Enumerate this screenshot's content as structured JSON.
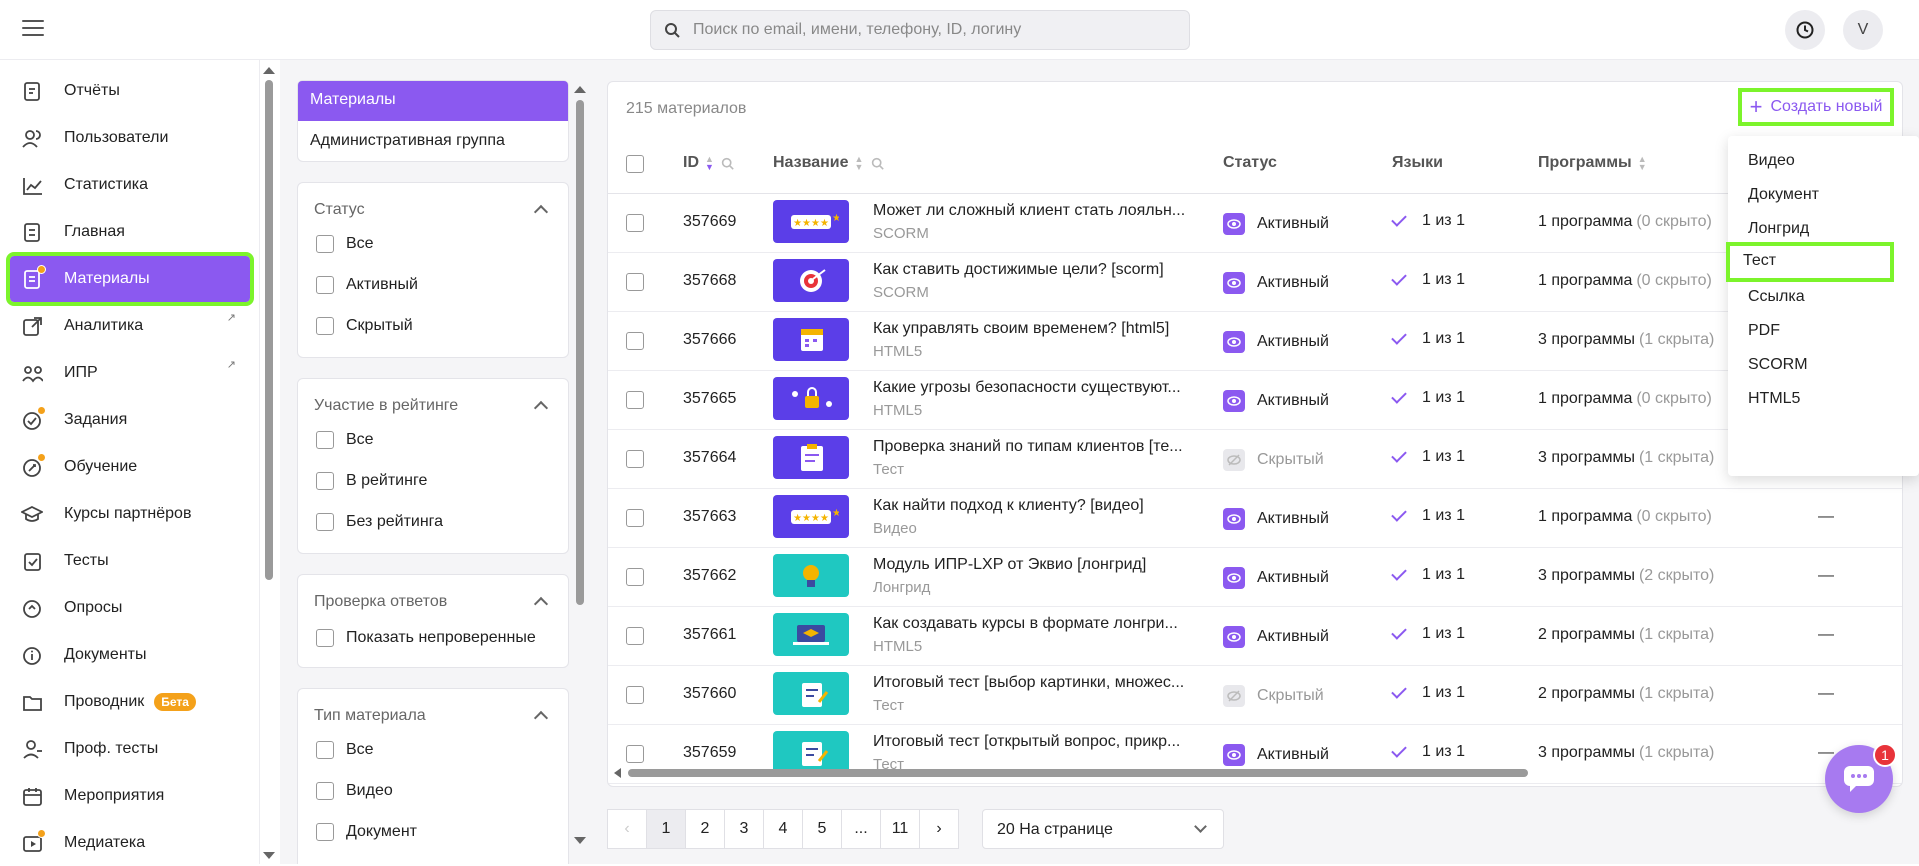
{
  "header": {
    "search_placeholder": "Поиск по email, имени, телефону, ID, логину",
    "avatar_letter": "V"
  },
  "sidebar": {
    "items": [
      {
        "label": "Отчёты",
        "icon": "reports-icon"
      },
      {
        "label": "Пользователи",
        "icon": "users-icon"
      },
      {
        "label": "Статистика",
        "icon": "chart-icon"
      },
      {
        "label": "Главная",
        "icon": "home-icon"
      },
      {
        "label": "Материалы",
        "icon": "materials-icon",
        "active": true
      },
      {
        "label": "Аналитика",
        "icon": "analytics-icon",
        "external": true
      },
      {
        "label": "ИПР",
        "icon": "ipr-icon",
        "external": true
      },
      {
        "label": "Задания",
        "icon": "tasks-icon"
      },
      {
        "label": "Обучение",
        "icon": "learning-icon"
      },
      {
        "label": "Курсы партнёров",
        "icon": "partner-courses-icon"
      },
      {
        "label": "Тесты",
        "icon": "tests-icon"
      },
      {
        "label": "Опросы",
        "icon": "surveys-icon"
      },
      {
        "label": "Документы",
        "icon": "documents-icon"
      },
      {
        "label": "Проводник",
        "icon": "folder-icon",
        "badge": "Бета"
      },
      {
        "label": "Проф. тесты",
        "icon": "prof-tests-icon"
      },
      {
        "label": "Мероприятия",
        "icon": "calendar-icon"
      },
      {
        "label": "Медиатека",
        "icon": "media-icon"
      }
    ]
  },
  "categories": {
    "active": "Материалы",
    "other": "Административная группа"
  },
  "filters": {
    "status": {
      "title": "Статус",
      "options": [
        "Все",
        "Активный",
        "Скрытый"
      ]
    },
    "rating": {
      "title": "Участие в рейтинге",
      "options": [
        "Все",
        "В рейтинге",
        "Без рейтинга"
      ]
    },
    "review": {
      "title": "Проверка ответов",
      "options": [
        "Показать непроверенные"
      ]
    },
    "type": {
      "title": "Тип материала",
      "options": [
        "Все",
        "Видео",
        "Документ"
      ]
    }
  },
  "table": {
    "count_label": "215 материалов",
    "create_label": "Создать новый",
    "columns": {
      "id": "ID",
      "name": "Название",
      "status": "Статус",
      "languages": "Языки",
      "programs": "Программы"
    },
    "rows": [
      {
        "id": "357669",
        "title": "Может ли сложный клиент стать лояльн...",
        "type": "SCORM",
        "status": "Активный",
        "lang": "1 из 1",
        "programs": "1 программа",
        "hidden": "(0 скрыто)",
        "extra": "",
        "thumb_color": "#5b3ee8",
        "thumb_icon": "stars-icon"
      },
      {
        "id": "357668",
        "title": "Как ставить достижимые цели? [scorm]",
        "type": "SCORM",
        "status": "Активный",
        "lang": "1 из 1",
        "programs": "1 программа",
        "hidden": "(0 скрыто)",
        "extra": "",
        "thumb_color": "#5b3ee8",
        "thumb_icon": "target-icon"
      },
      {
        "id": "357666",
        "title": "Как управлять своим временем? [html5]",
        "type": "HTML5",
        "status": "Активный",
        "lang": "1 из 1",
        "programs": "3 программы",
        "hidden": "(1 скрыта)",
        "extra": "",
        "thumb_color": "#5b3ee8",
        "thumb_icon": "calendar-icon"
      },
      {
        "id": "357665",
        "title": "Какие угрозы безопасности существуют...",
        "type": "HTML5",
        "status": "Активный",
        "lang": "1 из 1",
        "programs": "1 программа",
        "hidden": "(0 скрыто)",
        "extra": "",
        "thumb_color": "#5b3ee8",
        "thumb_icon": "lock-icon"
      },
      {
        "id": "357664",
        "title": "Проверка знаний по типам клиентов [те...",
        "type": "Тест",
        "status": "Скрытый",
        "lang": "1 из 1",
        "programs": "3 программы",
        "hidden": "(1 скрыта)",
        "extra": "",
        "thumb_color": "#5b3ee8",
        "thumb_icon": "clipboard-icon"
      },
      {
        "id": "357663",
        "title": "Как найти подход к клиенту? [видео]",
        "type": "Видео",
        "status": "Активный",
        "lang": "1 из 1",
        "programs": "1 программа",
        "hidden": "(0 скрыто)",
        "extra": "—",
        "thumb_color": "#5b3ee8",
        "thumb_icon": "stars-icon"
      },
      {
        "id": "357662",
        "title": "Модуль ИПР-LXP от Эквио [лонгрид]",
        "type": "Лонгрид",
        "status": "Активный",
        "lang": "1 из 1",
        "programs": "3 программы",
        "hidden": "(2 скрыто)",
        "extra": "—",
        "thumb_color": "#1fc8c1",
        "thumb_icon": "bulb-icon"
      },
      {
        "id": "357661",
        "title": "Как создавать курсы в формате лонгри...",
        "type": "HTML5",
        "status": "Активный",
        "lang": "1 из 1",
        "programs": "2 программы",
        "hidden": "(1 скрыта)",
        "extra": "—",
        "thumb_color": "#1fc8c1",
        "thumb_icon": "laptop-icon"
      },
      {
        "id": "357660",
        "title": "Итоговый тест [выбор картинки, множес...",
        "type": "Тест",
        "status": "Скрытый",
        "lang": "1 из 1",
        "programs": "2 программы",
        "hidden": "(1 скрыта)",
        "extra": "—",
        "thumb_color": "#1fc8c1",
        "thumb_icon": "document-icon"
      },
      {
        "id": "357659",
        "title": "Итоговый тест [открытый вопрос, прикр...",
        "type": "Тест",
        "status": "Активный",
        "lang": "1 из 1",
        "programs": "3 программы",
        "hidden": "(1 скрыта)",
        "extra": "—",
        "thumb_color": "#1fc8c1",
        "thumb_icon": "document-icon"
      }
    ]
  },
  "create_menu": {
    "items": [
      "Видео",
      "Документ",
      "Лонгрид",
      "Тест",
      "Ссылка",
      "PDF",
      "SCORM",
      "HTML5"
    ],
    "highlighted": "Тест"
  },
  "pagination": {
    "pages": [
      "1",
      "2",
      "3",
      "4",
      "5",
      "...",
      "11"
    ],
    "current": "1",
    "per_page": "20 На странице"
  },
  "chat": {
    "unread": "1"
  },
  "colors": {
    "accent": "#8b59f0",
    "highlight": "#7cf42b",
    "badge": "#f4a11a",
    "alert": "#e8333a"
  }
}
